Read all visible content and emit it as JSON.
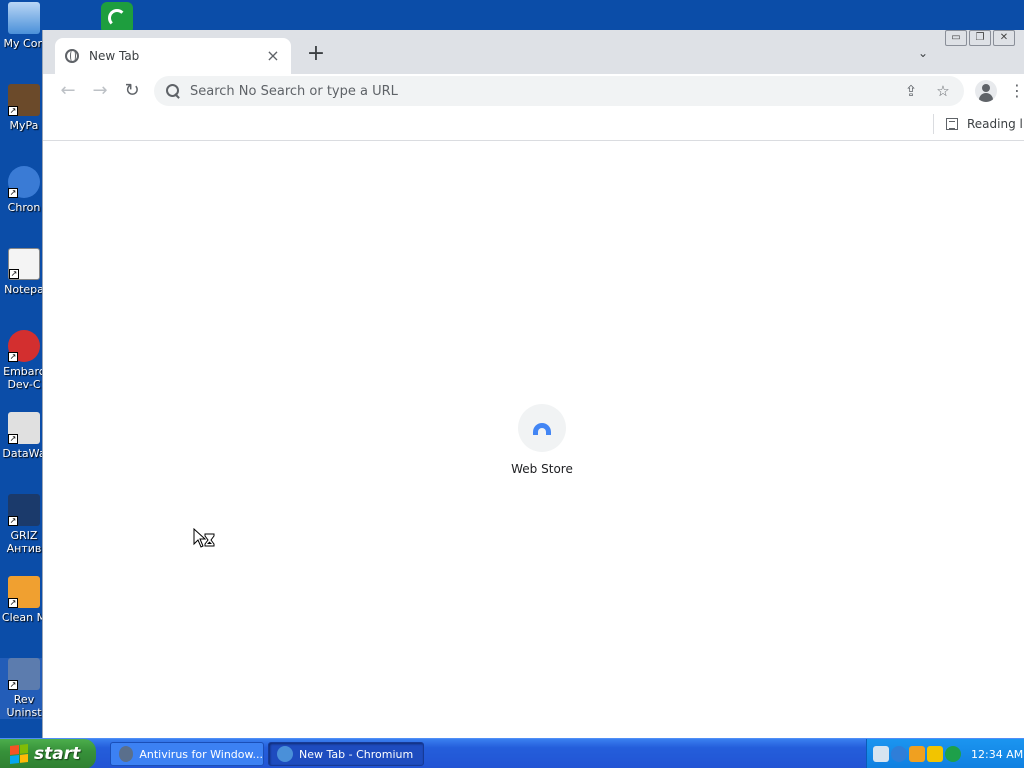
{
  "desktop": {
    "icons": [
      {
        "label": "My Con",
        "color": "#4a90d9"
      },
      {
        "label": "MyPa",
        "color": "#6b4a2a"
      },
      {
        "label": "Chron",
        "color": "#3a7bd5"
      },
      {
        "label": "Notepa",
        "color": "#8bc34a"
      },
      {
        "label": "Embarc Dev-C",
        "color": "#d32f2f"
      },
      {
        "label": "DataWa",
        "color": "#e0e0e0"
      },
      {
        "label": "GRIZ Антив",
        "color": "#1b3a6b"
      },
      {
        "label": "Clean M",
        "color": "#f0a030"
      },
      {
        "label": "Rev Uninst",
        "color": "#5c7cae"
      }
    ],
    "top_icon_color": "#1e9e3e"
  },
  "browser": {
    "tab": {
      "title": "New Tab",
      "close": "×"
    },
    "new_tab": "+",
    "tab_search": "⌄",
    "window_controls": {
      "minimize": "▭",
      "restore": "❐",
      "close": "✕"
    },
    "nav": {
      "back": "←",
      "forward": "→",
      "reload": "↻"
    },
    "omnibox": {
      "placeholder": "Search No Search or type a URL"
    },
    "omni_icons": {
      "share": "⇪",
      "bookmark": "☆"
    },
    "menu": "⋮",
    "reading_list": "Reading list",
    "shortcuts": [
      {
        "label": "Web Store"
      }
    ]
  },
  "taskbar": {
    "start_label": "start",
    "tasks": [
      {
        "label": "Antivirus for Window...",
        "icon_color": "#5a6f8c"
      },
      {
        "label": "New Tab - Chromium",
        "icon_color": "#4a90d9"
      }
    ],
    "tray_icons": [
      "#d6e4f0",
      "#2f7ed8",
      "#f0a020",
      "#f2c400",
      "#1ea04a"
    ],
    "clock": "12:34 AM"
  },
  "colors": {
    "desktop": "#0b4da8",
    "taskbar": "#245edb",
    "start": "#37923a",
    "tray": "#0f7fe0"
  }
}
